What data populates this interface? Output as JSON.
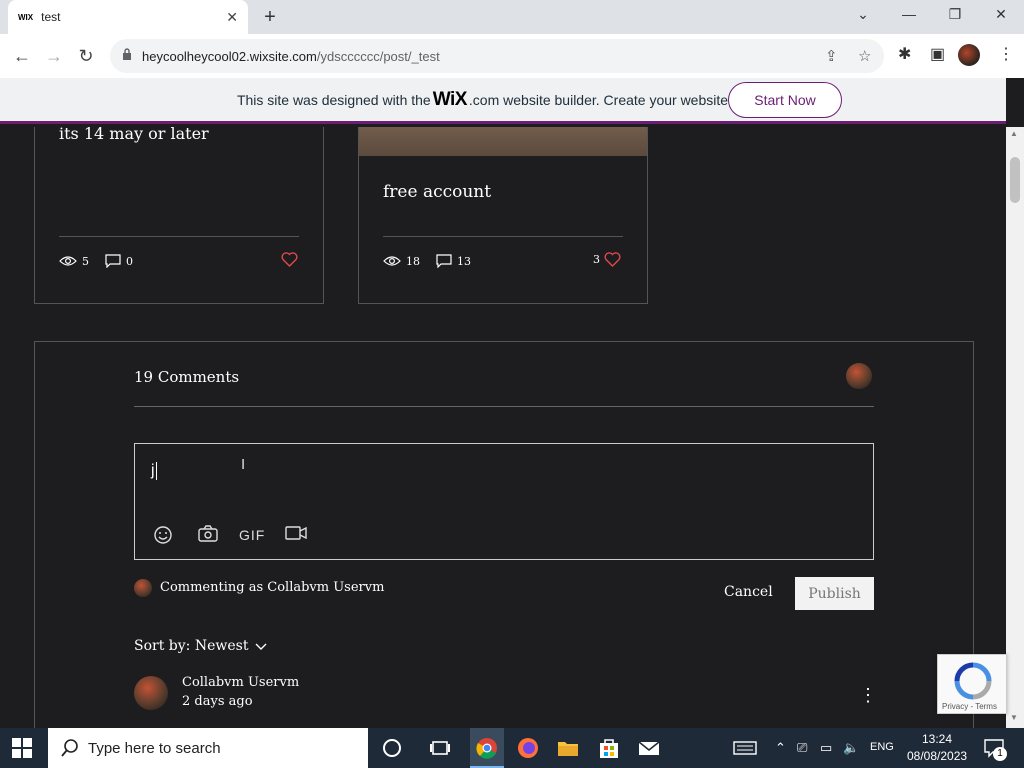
{
  "browser": {
    "tab_title": "test",
    "tab_favicon": "WIX",
    "url_host": "heycoolheycool02.wixsite.com",
    "url_path": "/ydscccccc/post/_test"
  },
  "wix_banner": {
    "text_before": "This site was designed with the",
    "logo": "WiX",
    "text_after": ".com website builder. Create your website today.",
    "cta": "Start Now"
  },
  "cards": [
    {
      "title": "its 14 may or later",
      "views": "5",
      "comments": "0",
      "likes": ""
    },
    {
      "title": "free account",
      "views": "18",
      "comments": "13",
      "likes": "3"
    }
  ],
  "comments": {
    "count_label": "19 Comments",
    "input_value": "j",
    "gif_label": "GIF",
    "commenting_as": "Commenting as Collabvm Uservm",
    "cancel_label": "Cancel",
    "publish_label": "Publish",
    "sort_label": "Sort by: Newest",
    "first_comment": {
      "author": "Collabvm Uservm",
      "time": "2 days ago"
    }
  },
  "recaptcha": {
    "terms": "Privacy - Terms"
  },
  "taskbar": {
    "search_placeholder": "Type here to search",
    "language": "ENG",
    "time": "13:24",
    "date": "08/08/2023",
    "notification_count": "1"
  },
  "colors": {
    "accent": "#6b1e74",
    "page_bg": "#1d1d1f",
    "like_red": "#e0484c"
  }
}
